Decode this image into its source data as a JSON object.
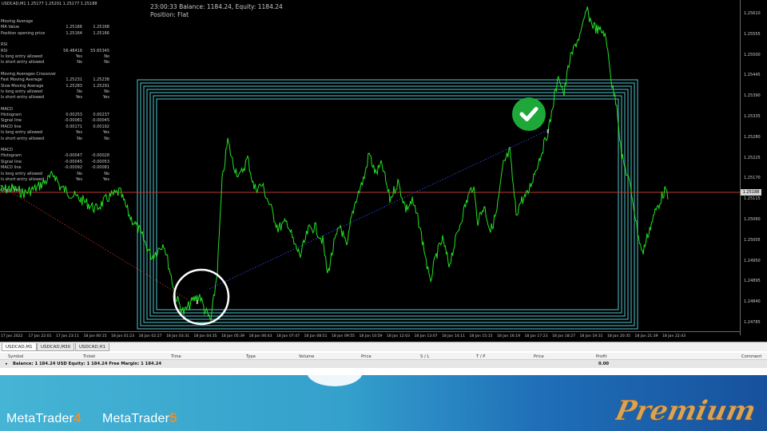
{
  "chart": {
    "symbol_header": "USDCAD,M1  1.25177 1.25201 1.25177 1.25188",
    "status_line1": "23:00:33 Balance: 1184.24, Equity: 1184.24",
    "status_line2": "Position: Flat",
    "indicator_sections": [
      {
        "rows": [
          {
            "label": "Moving Average",
            "v1": "",
            "v2": ""
          },
          {
            "label": "MA Value",
            "v1": "1.25166",
            "v2": "1.25168"
          },
          {
            "label": "Position opening price",
            "v1": "1.25164",
            "v2": "1.25166"
          }
        ]
      },
      {
        "rows": [
          {
            "label": "RSI",
            "v1": "",
            "v2": ""
          },
          {
            "label": "RSI",
            "v1": "56.48416",
            "v2": "55.65345"
          },
          {
            "label": "Is long entry allowed",
            "v1": "Yes",
            "v2": "No"
          },
          {
            "label": "Is short entry allowed",
            "v1": "No",
            "v2": "No"
          }
        ]
      },
      {
        "rows": [
          {
            "label": "Moving Averages Crossover",
            "v1": "",
            "v2": ""
          },
          {
            "label": "Fast Moving Average",
            "v1": "1.25231",
            "v2": "1.25238"
          },
          {
            "label": "Slow Moving Average",
            "v1": "1.25283",
            "v2": "1.25291"
          },
          {
            "label": "Is long entry allowed",
            "v1": "No",
            "v2": "No"
          },
          {
            "label": "Is short entry allowed",
            "v1": "Yes",
            "v2": "Yes"
          }
        ]
      },
      {
        "rows": [
          {
            "label": "MACD",
            "v1": "",
            "v2": ""
          },
          {
            "label": "Histogram",
            "v1": "0.00253",
            "v2": "0.00237"
          },
          {
            "label": "Signal line",
            "v1": "-0.00081",
            "v2": "-0.00045"
          },
          {
            "label": "MACD line",
            "v1": "0.00171",
            "v2": "0.00192"
          },
          {
            "label": "Is long entry allowed",
            "v1": "Yes",
            "v2": "Yes"
          },
          {
            "label": "Is short entry allowed",
            "v1": "No",
            "v2": "No"
          }
        ]
      },
      {
        "rows": [
          {
            "label": "MACD",
            "v1": "",
            "v2": ""
          },
          {
            "label": "Histogram",
            "v1": "-0.00047",
            "v2": "-0.00028"
          },
          {
            "label": "Signal line",
            "v1": "-0.00045",
            "v2": "-0.00053"
          },
          {
            "label": "MACD line",
            "v1": "-0.00092",
            "v2": "-0.00081"
          },
          {
            "label": "Is long entry allowed",
            "v1": "No",
            "v2": "No"
          },
          {
            "label": "Is short entry allowed",
            "v1": "Yes",
            "v2": "Yes"
          }
        ]
      },
      {
        "rows": [
          {
            "label": "Stop Limit",
            "v1": "",
            "v2": ""
          }
        ]
      }
    ],
    "price_ticks": [
      "1.25610",
      "1.25555",
      "1.25500",
      "1.25445",
      "1.25390",
      "1.25335",
      "1.25280",
      "1.25225",
      "1.25170",
      "1.25115",
      "1.25060",
      "1.25005",
      "1.24950",
      "1.24895",
      "1.24840",
      "1.24785"
    ],
    "current_price": "1.25188",
    "time_ticks": [
      "17 Jan 2022",
      "17 Jan 22:01",
      "17 Jan 23:11",
      "18 Jan 00:15",
      "18 Jan 01:23",
      "18 Jan 02:27",
      "18 Jan 03:31",
      "18 Jan 04:35",
      "18 Jan 05:39",
      "18 Jan 06:43",
      "18 Jan 07:47",
      "18 Jan 08:51",
      "18 Jan 09:55",
      "18 Jan 10:59",
      "18 Jan 12:03",
      "18 Jan 13:07",
      "18 Jan 14:11",
      "18 Jan 15:15",
      "18 Jan 16:19",
      "18 Jan 17:23",
      "18 Jan 18:27",
      "18 Jan 19:31",
      "18 Jan 20:35",
      "18 Jan 21:39",
      "18 Jan 22:43"
    ],
    "colors": {
      "price_line": "#22e022",
      "level_line": "#c0392b",
      "frame_lines": "#4fc3cc",
      "marker_circle": "#ffffff",
      "check_badge": "#1fa83a"
    }
  },
  "tabs": [
    "USDCAD,M1",
    "USDCAD,M30",
    "USDCAD,H1"
  ],
  "terminal": {
    "columns": [
      "Symbol",
      "Ticket",
      "Time",
      "Type",
      "Volume",
      "Price",
      "S / L",
      "T / P",
      "Price",
      "Profit",
      "Comment"
    ],
    "balance_text": "Balance: 1 184.24 USD  Equity: 1 184.24  Free Margin: 1 184.24",
    "profit_total": "0.00"
  },
  "banner": {
    "mt4_text": "MetaTrader",
    "mt4_num": "4",
    "mt5_text": "MetaTrader",
    "mt5_num": "5",
    "premium_text": "Premium"
  }
}
